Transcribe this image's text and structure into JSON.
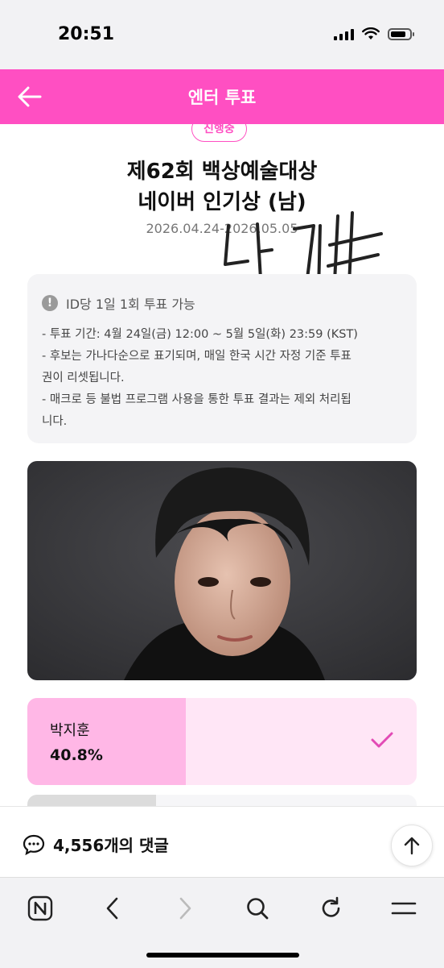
{
  "status_bar": {
    "time": "20:51"
  },
  "header": {
    "title": "엔터 투표"
  },
  "badge": {
    "label": "진행중"
  },
  "vote": {
    "title_line1": "제62회 백상예술대상",
    "title_line2": "네이버 인기상 (남)",
    "period": "2026.04.24-2026.05.05"
  },
  "notice": {
    "heading": "ID당 1일 1회 투표 가능",
    "lines": [
      "- 투표 기간: 4월 24일(금) 12:00 ~ 5월 5일(화) 23:59 (KST)",
      "- 후보는 가나다순으로 표기되며, 매일 한국 시간 자정 기준 투표",
      "권이 리셋됩니다.",
      "- 매크로 등 불법 프로그램 사용을 통한 투표 결과는 제외 처리됩",
      "니다."
    ]
  },
  "candidates": [
    {
      "name": "박지훈",
      "percent": "40.8%",
      "percent_value": 40.8,
      "selected": true
    }
  ],
  "comments": {
    "count_label": "4,556개의 댓글"
  },
  "colors": {
    "brand_pink": "#ff4fc2",
    "vote_fill": "#ffb7e6",
    "vote_bg": "#ffe6f6"
  },
  "icons": {
    "back": "arrow-left-icon",
    "info": "info-icon",
    "check": "check-icon",
    "comment": "comment-bubble-icon",
    "scroll_top": "arrow-up-icon",
    "toolbar": [
      "naver-home-icon",
      "back-chevron-icon",
      "forward-chevron-icon",
      "search-icon",
      "refresh-icon",
      "menu-icon"
    ]
  }
}
